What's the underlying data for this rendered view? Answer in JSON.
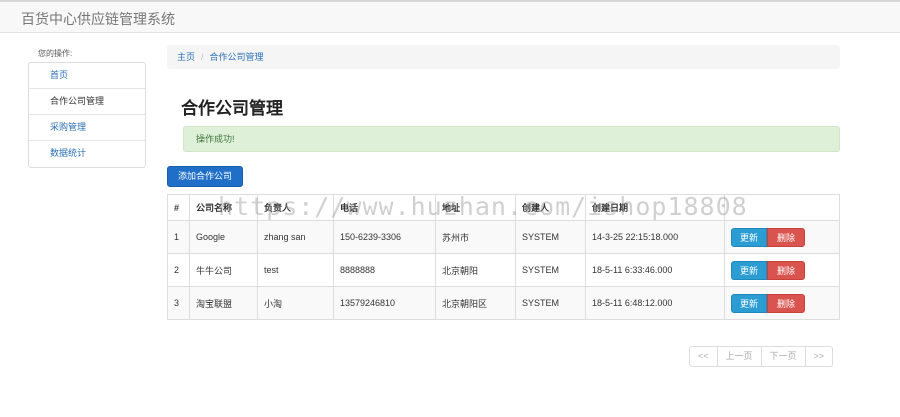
{
  "app": {
    "title": "百货中心供应链管理系统"
  },
  "sidebar": {
    "title": "您的操作:",
    "items": [
      {
        "label": "首页"
      },
      {
        "label": "合作公司管理"
      },
      {
        "label": "采购管理"
      },
      {
        "label": "数据统计"
      }
    ]
  },
  "breadcrumb": {
    "home": "主页",
    "separator": "/",
    "current": "合作公司管理"
  },
  "page": {
    "title": "合作公司管理"
  },
  "alert": {
    "message": "操作成功!"
  },
  "actions": {
    "add_label": "添加合作公司"
  },
  "table": {
    "headers": [
      "#",
      "公司名称",
      "负责人",
      "电话",
      "地址",
      "创建人",
      "创建日期",
      ""
    ],
    "rows": [
      {
        "num": "1",
        "name": "Google",
        "owner": "zhang san",
        "phone": "150-6239-3306",
        "address": "苏州市",
        "creator": "SYSTEM",
        "date": "14-3-25 22:15:18.000",
        "update": "更新",
        "delete": "删除"
      },
      {
        "num": "2",
        "name": "牛牛公司",
        "owner": "test",
        "phone": "8888888",
        "address": "北京朝阳",
        "creator": "SYSTEM",
        "date": "18-5-11 6:33:46.000",
        "update": "更新",
        "delete": "删除"
      },
      {
        "num": "3",
        "name": "淘宝联盟",
        "owner": "小淘",
        "phone": "13579246810",
        "address": "北京朝阳区",
        "creator": "SYSTEM",
        "date": "18-5-11 6:48:12.000",
        "update": "更新",
        "delete": "删除"
      }
    ]
  },
  "pager": {
    "first": "<<",
    "prev": "上一页",
    "next": "下一页",
    "last": ">>"
  },
  "watermark": "https://www.huzhan.com/ishop18808",
  "colors": {
    "accent": "#1f6fc8",
    "update": "#2b9dd3",
    "delete": "#d9534f",
    "alert_bg": "#dff0d8",
    "alert_text": "#3c763d"
  }
}
